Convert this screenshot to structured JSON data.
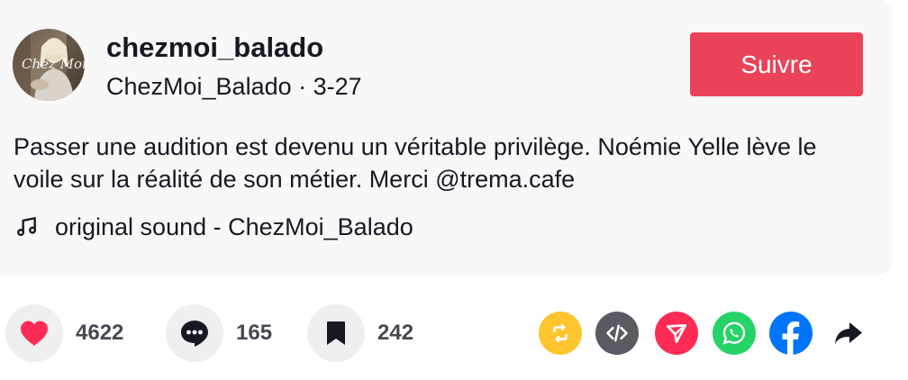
{
  "author": {
    "username": "chezmoi_balado",
    "display_name": "ChezMoi_Balado",
    "separator": "·",
    "date": "3-27",
    "avatar_text": "Chez Moi"
  },
  "follow_button": {
    "label": "Suivre",
    "color": "#ea4359"
  },
  "post": {
    "description": "Passer une audition est devenu un véritable privilège. Noémie Yelle lève le voile sur la réalité de son métier. Merci ",
    "mention": "@trema.cafe"
  },
  "sound": {
    "icon": "music-note-icon",
    "label": "original sound - ChezMoi_Balado"
  },
  "actions": {
    "likes": {
      "icon": "heart-icon",
      "count": "4622",
      "color": "#fe2c55"
    },
    "comments": {
      "icon": "comment-icon",
      "count": "165"
    },
    "saves": {
      "icon": "bookmark-icon",
      "count": "242"
    }
  },
  "share_buttons": [
    {
      "name": "repost",
      "icon": "repost-icon",
      "color": "#fec52e"
    },
    {
      "name": "embed",
      "icon": "embed-code-icon",
      "color": "#5a5b62"
    },
    {
      "name": "send",
      "icon": "send-icon",
      "color": "#fe2c55"
    },
    {
      "name": "whatsapp",
      "icon": "whatsapp-icon",
      "color": "#25d366"
    },
    {
      "name": "facebook",
      "icon": "facebook-icon",
      "color": "#0075fa"
    },
    {
      "name": "more",
      "icon": "share-arrow-icon",
      "color": "#161823"
    }
  ]
}
